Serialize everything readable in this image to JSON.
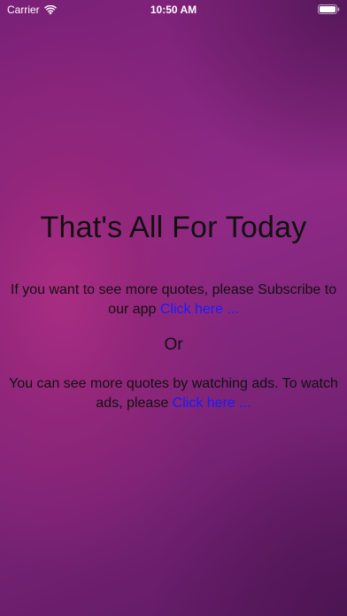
{
  "status_bar": {
    "carrier": "Carrier",
    "time": "10:50 AM",
    "icons": [
      "wifi-icon",
      "battery-icon"
    ]
  },
  "main": {
    "title": "That's All For Today",
    "subscribe_text": "If you want to see more quotes, please Subscribe to our app ",
    "subscribe_link": "Click here ...",
    "or_text": "Or",
    "ads_text": "You can see more quotes by watching ads. To watch ads, please ",
    "ads_link": "Click here ..."
  },
  "colors": {
    "background_primary": "#8f2a86",
    "background_dark": "#5e1a63",
    "text": "#111111",
    "link": "#1a1aff"
  }
}
